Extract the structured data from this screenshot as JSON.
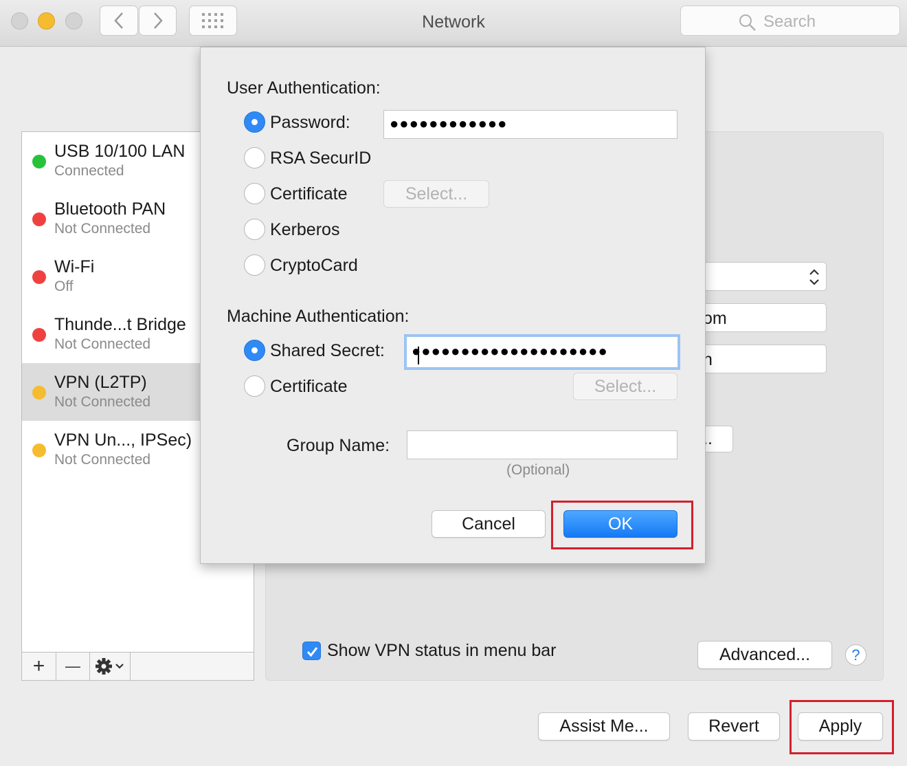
{
  "window": {
    "title": "Network",
    "search_placeholder": "Search"
  },
  "services": [
    {
      "name": "USB 10/100 LAN",
      "status": "Connected",
      "color": "#27c23a",
      "selected": false
    },
    {
      "name": "Bluetooth PAN",
      "status": "Not Connected",
      "color": "#f04141",
      "selected": false
    },
    {
      "name": "Wi-Fi",
      "status": "Off",
      "color": "#f04141",
      "selected": false
    },
    {
      "name": "Thunde...t Bridge",
      "status": "Not Connected",
      "color": "#f04141",
      "selected": false
    },
    {
      "name": "VPN (L2TP)",
      "status": "Not Connected",
      "color": "#f6bc2f",
      "selected": true
    },
    {
      "name": "VPN Un..., IPSec)",
      "status": "Not Connected",
      "color": "#f6bc2f",
      "selected": false
    }
  ],
  "sidebar_toolbar": {
    "add": "+",
    "remove": "—"
  },
  "detail": {
    "frag_server_text": "om",
    "frag_account_text": "n",
    "frag_button_text": "..",
    "show_status_label": "Show VPN status in menu bar",
    "show_status_checked": true,
    "advanced_label": "Advanced...",
    "help_label": "?"
  },
  "dialog": {
    "user_auth_label": "User Authentication:",
    "user_auth_options": [
      {
        "label": "Password:",
        "selected": true
      },
      {
        "label": "RSA SecurID",
        "selected": false
      },
      {
        "label": "Certificate",
        "selected": false
      },
      {
        "label": "Kerberos",
        "selected": false
      },
      {
        "label": "CryptoCard",
        "selected": false
      }
    ],
    "password_value": "●●●●●●●●●●●●",
    "cert_select_label": "Select...",
    "machine_auth_label": "Machine Authentication:",
    "machine_auth_options": [
      {
        "label": "Shared Secret:",
        "selected": true
      },
      {
        "label": "Certificate",
        "selected": false
      }
    ],
    "shared_secret_value": "●●●●●●●●●●●●●●●●●●●●",
    "machine_cert_select_label": "Select...",
    "group_name_label": "Group Name:",
    "group_name_value": "",
    "group_name_hint": "(Optional)",
    "cancel_label": "Cancel",
    "ok_label": "OK"
  },
  "footer": {
    "assist_label": "Assist Me...",
    "revert_label": "Revert",
    "apply_label": "Apply"
  },
  "colors": {
    "accent": "#2f8af5",
    "highlight": "#d2202c"
  }
}
